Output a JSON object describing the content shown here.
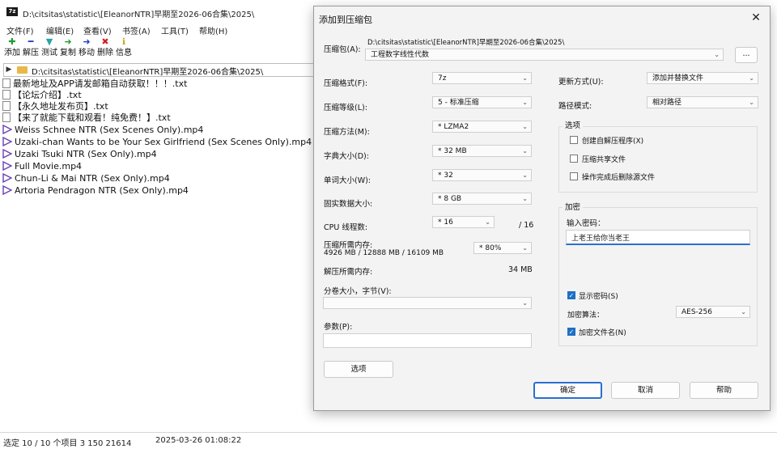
{
  "window": {
    "title": "D:\\citsitas\\statistic\\[EleanorNTR]早期至2026-06合集\\2025\\"
  },
  "menu": [
    "文件(F)",
    "编辑(E)",
    "查看(V)",
    "书签(A)",
    "工具(T)",
    "帮助(H)"
  ],
  "toolbar": [
    {
      "label": "添加",
      "icon": "plus-icon",
      "color": "#1e9e2f",
      "glyph": "✚"
    },
    {
      "label": "解压",
      "icon": "minus-icon",
      "color": "#1f3fbf",
      "glyph": "━"
    },
    {
      "label": "测试",
      "icon": "check-icon",
      "color": "#2aa3a3",
      "glyph": "▼"
    },
    {
      "label": "复制",
      "icon": "copy-arrow-icon",
      "color": "#1e9e2f",
      "glyph": "➜"
    },
    {
      "label": "移动",
      "icon": "move-arrow-icon",
      "color": "#1f3fbf",
      "glyph": "➜"
    },
    {
      "label": "删除",
      "icon": "delete-x-icon",
      "color": "#d21f1f",
      "glyph": "✖"
    },
    {
      "label": "信息",
      "icon": "info-icon",
      "color": "#c9a21a",
      "glyph": "ℹ"
    }
  ],
  "address": {
    "path": "D:\\citsitas\\statistic\\[EleanorNTR]早期至2026-06合集\\2025\\"
  },
  "files": [
    {
      "name": "最新地址及APP请发邮箱自动获取！！！.txt",
      "type": "txt"
    },
    {
      "name": "【论坛介绍】.txt",
      "type": "txt"
    },
    {
      "name": "【永久地址发布页】.txt",
      "type": "txt"
    },
    {
      "name": "【来了就能下载和观看！纯免费！】.txt",
      "type": "txt"
    },
    {
      "name": "Weiss Schnee NTR (Sex Scenes Only).mp4",
      "type": "mp4"
    },
    {
      "name": "Uzaki-chan Wants to be Your Sex Girlfriend (Sex Scenes Only).mp4",
      "type": "mp4"
    },
    {
      "name": "Uzaki Tsuki NTR (Sex Only).mp4",
      "type": "mp4"
    },
    {
      "name": "Full Movie.mp4",
      "type": "mp4"
    },
    {
      "name": "Chun-Li & Mai NTR (Sex Only).mp4",
      "type": "mp4"
    },
    {
      "name": "Artoria Pendragon NTR (Sex Only).mp4",
      "type": "mp4"
    }
  ],
  "status": {
    "selection": "选定 10 / 10 个项目 3 150 21614",
    "datetime": "2025-03-26 01:08:22"
  },
  "dialog": {
    "title": "添加到压缩包",
    "archive_label": "压缩包(A):",
    "archive_path": "D:\\citsitas\\statistic\\[EleanorNTR]早期至2026-06合集\\2025\\",
    "archive_name": "工程数字线性代数",
    "browse_label": "...",
    "format_label": "压缩格式(F):",
    "format_value": "7z",
    "level_label": "压缩等级(L):",
    "level_value": "5 - 标准压缩",
    "method_label": "压缩方法(M):",
    "method_value": "* LZMA2",
    "dict_label": "字典大小(D):",
    "dict_value": "* 32 MB",
    "word_label": "单词大小(W):",
    "word_value": "* 32",
    "solid_label": "固实数据大小:",
    "solid_value": "* 8 GB",
    "cpu_label": "CPU 线程数:",
    "cpu_value": "* 16",
    "cpu_total": "/ 16",
    "mem_label": "压缩所需内存:",
    "mem_value": "4926 MB / 12888 MB / 16109 MB",
    "mem_percent": "* 80%",
    "decomp_label": "解压所需内存:",
    "decomp_value": "34 MB",
    "split_label": "分卷大小，字节(V):",
    "split_value": "",
    "params_label": "参数(P):",
    "params_value": "",
    "options_button": "选项",
    "update_label": "更新方式(U):",
    "update_value": "添加并替换文件",
    "path_label": "路径模式:",
    "path_value": "相对路径",
    "options_group": "选项",
    "opt_sfx": "创建自解压程序(X)",
    "opt_shared": "压缩共享文件",
    "opt_delete": "操作完成后删除源文件",
    "encrypt_group": "加密",
    "password_label": "输入密码：",
    "password_value": "上老王给你当老王",
    "show_password": "显示密码(S)",
    "encrypt_method_label": "加密算法：",
    "encrypt_method_value": "AES-256",
    "encrypt_names": "加密文件名(N)",
    "ok_button": "确定",
    "cancel_button": "取消",
    "help_button": "帮助"
  }
}
